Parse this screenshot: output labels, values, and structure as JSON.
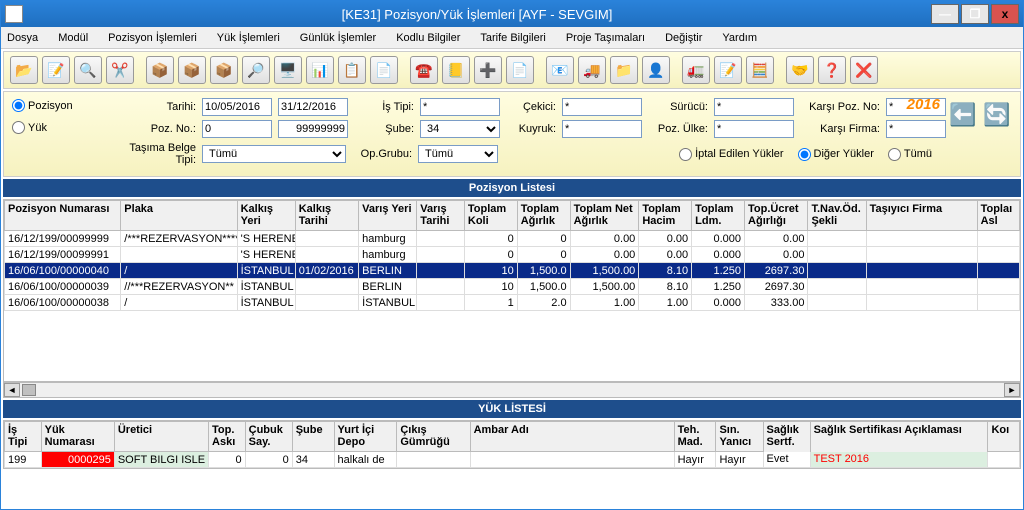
{
  "window": {
    "title": "[KE31] Pozisyon/Yük İşlemleri [AYF - SEVGIM]",
    "min": "—",
    "max": "❐",
    "close": "x"
  },
  "menu": {
    "dosya": "Dosya",
    "modul": "Modül",
    "pozisyon": "Pozisyon İşlemleri",
    "yuk": "Yük İşlemleri",
    "gunluk": "Günlük İşlemler",
    "kodlu": "Kodlu Bilgiler",
    "tarife": "Tarife Bilgileri",
    "proje": "Proje Taşımaları",
    "degistir": "Değiştir",
    "yardim": "Yardım"
  },
  "filter": {
    "pozisyon": "Pozisyon",
    "yuk": "Yük",
    "tarihi_lbl": "Tarihi:",
    "tarihi_from": "10/05/2016",
    "tarihi_to": "31/12/2016",
    "pozno_lbl": "Poz. No.:",
    "pozno_from": "0",
    "pozno_to": "99999999",
    "belge_lbl": "Taşıma Belge Tipi:",
    "belge_val": "Tümü",
    "istipi_lbl": "İş Tipi:",
    "istipi_val": "*",
    "sube_lbl": "Şube:",
    "sube_val": "34",
    "opgrubu_lbl": "Op.Grubu:",
    "opgrubu_val": "Tümü",
    "cekici_lbl": "Çekici:",
    "cekici_val": "*",
    "kuyruk_lbl": "Kuyruk:",
    "kuyruk_val": "*",
    "surucu_lbl": "Sürücü:",
    "surucu_val": "*",
    "pozulke_lbl": "Poz. Ülke:",
    "pozulke_val": "*",
    "karsipoz_lbl": "Karşı Poz. No:",
    "karsipoz_val": "*",
    "karsifirma_lbl": "Karşı Firma:",
    "karsifirma_val": "*",
    "year_badge": "2016",
    "iptal": "İptal Edilen Yükler",
    "diger": "Diğer Yükler",
    "tumu": "Tümü"
  },
  "poz_hdr": "Pozisyon Listesi",
  "poz_cols": {
    "pozno": "Pozisyon Numarası",
    "plaka": "Plaka",
    "kalkis_yer": "Kalkış Yeri",
    "kalkis_tar": "Kalkış Tarihi",
    "varis_yer": "Varış Yeri",
    "varis_tar": "Varış Tarihi",
    "koli": "Toplam Koli",
    "agirlik": "Toplam Ağırlık",
    "netag": "Toplam Net Ağırlık",
    "hacim": "Toplam Hacim",
    "ldm": "Toplam Ldm.",
    "ucret": "Top.Ücret Ağırlığı",
    "navod": "T.Nav.Öd. Şekli",
    "tasiyici": "Taşıyıcı Firma",
    "toplam_asi": "Toplaı Asl"
  },
  "poz_rows": [
    {
      "no": "16/12/199/00099999",
      "plaka": "/***REZERVASYON****",
      "ky": "'S HERENE",
      "kt": "",
      "vy": "hamburg",
      "vt": "",
      "koli": "0",
      "ag": "0",
      "net": "0.00",
      "hac": "0.00",
      "ldm": "0.000",
      "ucr": "0.00"
    },
    {
      "no": "16/12/199/00099991",
      "plaka": "",
      "ky": "'S HERENE",
      "kt": "",
      "vy": "hamburg",
      "vt": "",
      "koli": "0",
      "ag": "0",
      "net": "0.00",
      "hac": "0.00",
      "ldm": "0.000",
      "ucr": "0.00"
    },
    {
      "no": "16/06/100/00000040",
      "plaka": "/",
      "ky": "İSTANBUL",
      "kt": "01/02/2016",
      "vy": "BERLIN",
      "vt": "",
      "koli": "10",
      "ag": "1,500.0",
      "net": "1,500.00",
      "hac": "8.10",
      "ldm": "1.250",
      "ucr": "2697.30",
      "sel": true
    },
    {
      "no": "16/06/100/00000039",
      "plaka": "//***REZERVASYON**",
      "ky": "İSTANBUL",
      "kt": "",
      "vy": "BERLIN",
      "vt": "",
      "koli": "10",
      "ag": "1,500.0",
      "net": "1,500.00",
      "hac": "8.10",
      "ldm": "1.250",
      "ucr": "2697.30"
    },
    {
      "no": "16/06/100/00000038",
      "plaka": "/",
      "ky": "İSTANBUL",
      "kt": "",
      "vy": "İSTANBUL",
      "vt": "",
      "koli": "1",
      "ag": "2.0",
      "net": "1.00",
      "hac": "1.00",
      "ldm": "0.000",
      "ucr": "333.00"
    }
  ],
  "yuk_hdr": "YÜK LİSTESİ",
  "yuk_cols": {
    "istipi": "İş Tipi",
    "yukno": "Yük Numarası",
    "uretici": "Üretici",
    "topaski": "Top. Askı",
    "cubuk": "Çubuk Say.",
    "sube": "Şube",
    "yurt": "Yurt İçi Depo",
    "cikis": "Çıkış Gümrüğü",
    "ambar": "Ambar Adı",
    "teh": "Teh. Mad.",
    "sin": "Sın. Yanıcı",
    "saglik": "Sağlık Sertf.",
    "aciklama": "Sağlık Sertifikası Açıklaması",
    "kol": "Koı"
  },
  "yuk_row": {
    "istipi": "199",
    "yukno": "0000295",
    "uretici": "SOFT BILGI ISLE",
    "topaski": "0",
    "cubuk": "0",
    "sube": "34",
    "yurt": "halkalı de",
    "cikis": "",
    "ambar": "",
    "teh": "Hayır",
    "sin": "Hayır",
    "saglik": "Evet",
    "aciklama": "TEST 2016"
  },
  "scroll": {
    "left": "◄",
    "right": "►"
  }
}
